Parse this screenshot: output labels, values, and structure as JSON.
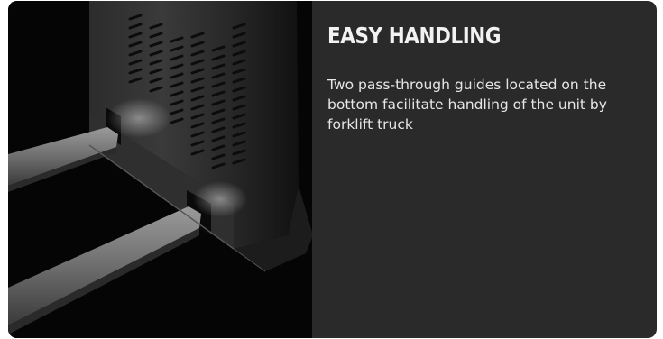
{
  "feature": {
    "title": "EASY HANDLING",
    "description": "Two pass-through guides located on the bottom facilitate handling of the unit by forklift truck",
    "image_alt": "unit-with-forklift-guides"
  },
  "colors": {
    "card_background": "#2a2a2a",
    "image_background": "#050505",
    "text": "#e6e6e6"
  }
}
